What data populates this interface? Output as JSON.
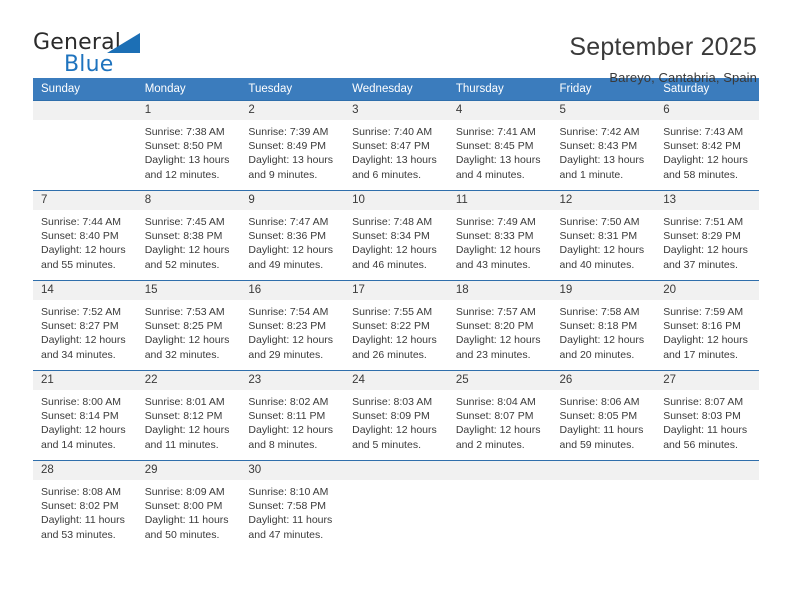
{
  "brand": {
    "name_top": "General",
    "name_bottom": "Blue",
    "accent_color": "#1c6fb5"
  },
  "header": {
    "title": "September 2025",
    "subtitle": "Bareyo, Cantabria, Spain"
  },
  "calendar": {
    "header_bg": "#3b7cbd",
    "daynum_bg": "#f1f1f1",
    "row_border": "#2f6eab",
    "weekday_headers": [
      "Sunday",
      "Monday",
      "Tuesday",
      "Wednesday",
      "Thursday",
      "Friday",
      "Saturday"
    ],
    "weeks": [
      [
        {
          "day": "",
          "sunrise": "",
          "sunset": "",
          "daylight": "",
          "daylight2": ""
        },
        {
          "day": "1",
          "sunrise": "Sunrise: 7:38 AM",
          "sunset": "Sunset: 8:50 PM",
          "daylight": "Daylight: 13 hours",
          "daylight2": "and 12 minutes."
        },
        {
          "day": "2",
          "sunrise": "Sunrise: 7:39 AM",
          "sunset": "Sunset: 8:49 PM",
          "daylight": "Daylight: 13 hours",
          "daylight2": "and 9 minutes."
        },
        {
          "day": "3",
          "sunrise": "Sunrise: 7:40 AM",
          "sunset": "Sunset: 8:47 PM",
          "daylight": "Daylight: 13 hours",
          "daylight2": "and 6 minutes."
        },
        {
          "day": "4",
          "sunrise": "Sunrise: 7:41 AM",
          "sunset": "Sunset: 8:45 PM",
          "daylight": "Daylight: 13 hours",
          "daylight2": "and 4 minutes."
        },
        {
          "day": "5",
          "sunrise": "Sunrise: 7:42 AM",
          "sunset": "Sunset: 8:43 PM",
          "daylight": "Daylight: 13 hours",
          "daylight2": "and 1 minute."
        },
        {
          "day": "6",
          "sunrise": "Sunrise: 7:43 AM",
          "sunset": "Sunset: 8:42 PM",
          "daylight": "Daylight: 12 hours",
          "daylight2": "and 58 minutes."
        }
      ],
      [
        {
          "day": "7",
          "sunrise": "Sunrise: 7:44 AM",
          "sunset": "Sunset: 8:40 PM",
          "daylight": "Daylight: 12 hours",
          "daylight2": "and 55 minutes."
        },
        {
          "day": "8",
          "sunrise": "Sunrise: 7:45 AM",
          "sunset": "Sunset: 8:38 PM",
          "daylight": "Daylight: 12 hours",
          "daylight2": "and 52 minutes."
        },
        {
          "day": "9",
          "sunrise": "Sunrise: 7:47 AM",
          "sunset": "Sunset: 8:36 PM",
          "daylight": "Daylight: 12 hours",
          "daylight2": "and 49 minutes."
        },
        {
          "day": "10",
          "sunrise": "Sunrise: 7:48 AM",
          "sunset": "Sunset: 8:34 PM",
          "daylight": "Daylight: 12 hours",
          "daylight2": "and 46 minutes."
        },
        {
          "day": "11",
          "sunrise": "Sunrise: 7:49 AM",
          "sunset": "Sunset: 8:33 PM",
          "daylight": "Daylight: 12 hours",
          "daylight2": "and 43 minutes."
        },
        {
          "day": "12",
          "sunrise": "Sunrise: 7:50 AM",
          "sunset": "Sunset: 8:31 PM",
          "daylight": "Daylight: 12 hours",
          "daylight2": "and 40 minutes."
        },
        {
          "day": "13",
          "sunrise": "Sunrise: 7:51 AM",
          "sunset": "Sunset: 8:29 PM",
          "daylight": "Daylight: 12 hours",
          "daylight2": "and 37 minutes."
        }
      ],
      [
        {
          "day": "14",
          "sunrise": "Sunrise: 7:52 AM",
          "sunset": "Sunset: 8:27 PM",
          "daylight": "Daylight: 12 hours",
          "daylight2": "and 34 minutes."
        },
        {
          "day": "15",
          "sunrise": "Sunrise: 7:53 AM",
          "sunset": "Sunset: 8:25 PM",
          "daylight": "Daylight: 12 hours",
          "daylight2": "and 32 minutes."
        },
        {
          "day": "16",
          "sunrise": "Sunrise: 7:54 AM",
          "sunset": "Sunset: 8:23 PM",
          "daylight": "Daylight: 12 hours",
          "daylight2": "and 29 minutes."
        },
        {
          "day": "17",
          "sunrise": "Sunrise: 7:55 AM",
          "sunset": "Sunset: 8:22 PM",
          "daylight": "Daylight: 12 hours",
          "daylight2": "and 26 minutes."
        },
        {
          "day": "18",
          "sunrise": "Sunrise: 7:57 AM",
          "sunset": "Sunset: 8:20 PM",
          "daylight": "Daylight: 12 hours",
          "daylight2": "and 23 minutes."
        },
        {
          "day": "19",
          "sunrise": "Sunrise: 7:58 AM",
          "sunset": "Sunset: 8:18 PM",
          "daylight": "Daylight: 12 hours",
          "daylight2": "and 20 minutes."
        },
        {
          "day": "20",
          "sunrise": "Sunrise: 7:59 AM",
          "sunset": "Sunset: 8:16 PM",
          "daylight": "Daylight: 12 hours",
          "daylight2": "and 17 minutes."
        }
      ],
      [
        {
          "day": "21",
          "sunrise": "Sunrise: 8:00 AM",
          "sunset": "Sunset: 8:14 PM",
          "daylight": "Daylight: 12 hours",
          "daylight2": "and 14 minutes."
        },
        {
          "day": "22",
          "sunrise": "Sunrise: 8:01 AM",
          "sunset": "Sunset: 8:12 PM",
          "daylight": "Daylight: 12 hours",
          "daylight2": "and 11 minutes."
        },
        {
          "day": "23",
          "sunrise": "Sunrise: 8:02 AM",
          "sunset": "Sunset: 8:11 PM",
          "daylight": "Daylight: 12 hours",
          "daylight2": "and 8 minutes."
        },
        {
          "day": "24",
          "sunrise": "Sunrise: 8:03 AM",
          "sunset": "Sunset: 8:09 PM",
          "daylight": "Daylight: 12 hours",
          "daylight2": "and 5 minutes."
        },
        {
          "day": "25",
          "sunrise": "Sunrise: 8:04 AM",
          "sunset": "Sunset: 8:07 PM",
          "daylight": "Daylight: 12 hours",
          "daylight2": "and 2 minutes."
        },
        {
          "day": "26",
          "sunrise": "Sunrise: 8:06 AM",
          "sunset": "Sunset: 8:05 PM",
          "daylight": "Daylight: 11 hours",
          "daylight2": "and 59 minutes."
        },
        {
          "day": "27",
          "sunrise": "Sunrise: 8:07 AM",
          "sunset": "Sunset: 8:03 PM",
          "daylight": "Daylight: 11 hours",
          "daylight2": "and 56 minutes."
        }
      ],
      [
        {
          "day": "28",
          "sunrise": "Sunrise: 8:08 AM",
          "sunset": "Sunset: 8:02 PM",
          "daylight": "Daylight: 11 hours",
          "daylight2": "and 53 minutes."
        },
        {
          "day": "29",
          "sunrise": "Sunrise: 8:09 AM",
          "sunset": "Sunset: 8:00 PM",
          "daylight": "Daylight: 11 hours",
          "daylight2": "and 50 minutes."
        },
        {
          "day": "30",
          "sunrise": "Sunrise: 8:10 AM",
          "sunset": "Sunset: 7:58 PM",
          "daylight": "Daylight: 11 hours",
          "daylight2": "and 47 minutes."
        },
        {
          "day": "",
          "sunrise": "",
          "sunset": "",
          "daylight": "",
          "daylight2": ""
        },
        {
          "day": "",
          "sunrise": "",
          "sunset": "",
          "daylight": "",
          "daylight2": ""
        },
        {
          "day": "",
          "sunrise": "",
          "sunset": "",
          "daylight": "",
          "daylight2": ""
        },
        {
          "day": "",
          "sunrise": "",
          "sunset": "",
          "daylight": "",
          "daylight2": ""
        }
      ]
    ]
  }
}
